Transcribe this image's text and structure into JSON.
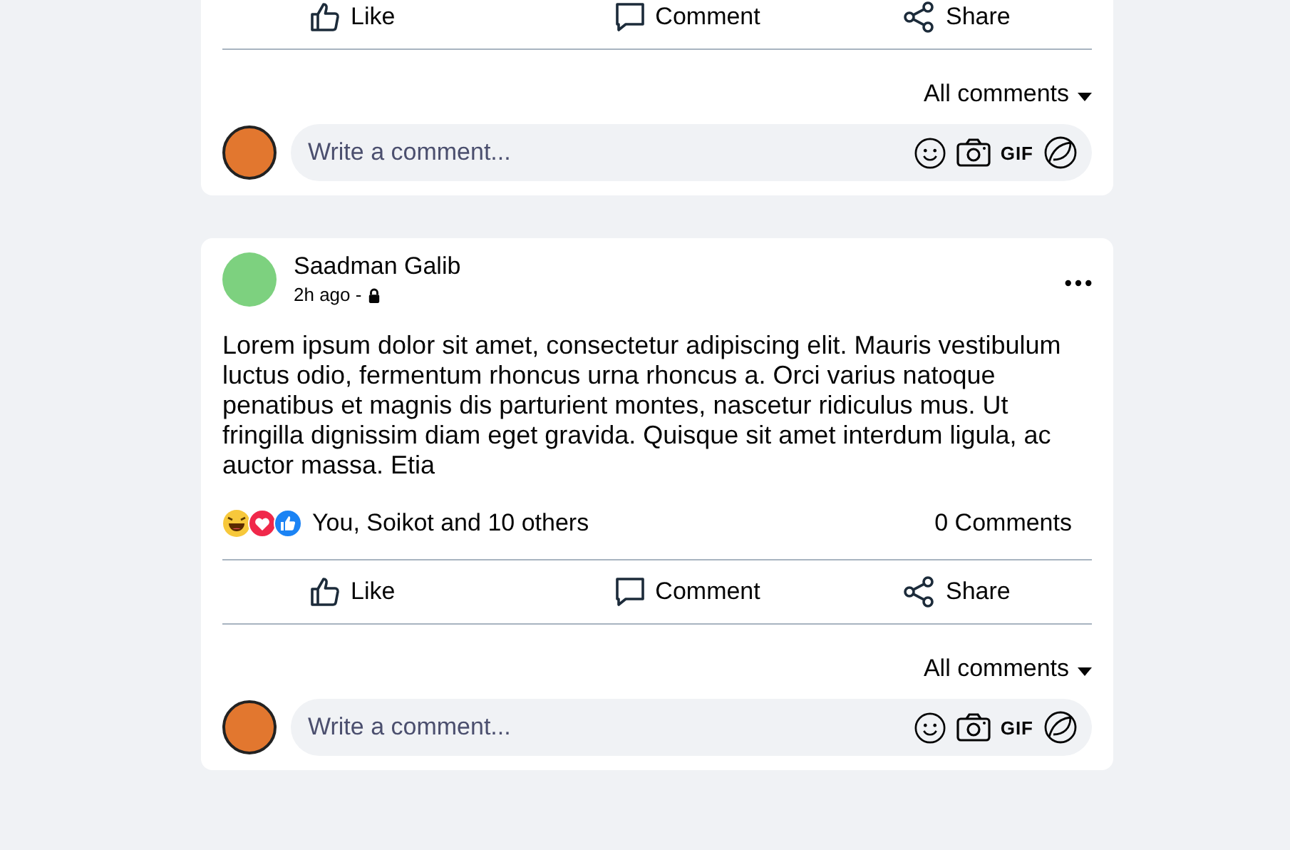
{
  "posts": [
    {
      "actions": [
        "Like",
        "Comment",
        "Share"
      ],
      "comments_filter": "All comments",
      "comment_field": {
        "placeholder": "Write a comment...",
        "gif_label": "GIF"
      }
    },
    {
      "author": {
        "name": "Saadman Galib",
        "time": "2h ago -"
      },
      "body": "Lorem ipsum dolor sit amet, consectetur adipiscing elit. Mauris vestibulum luctus odio, fermentum rhoncus urna rhoncus a. Orci varius natoque penatibus et magnis dis parturient montes, nascetur ridiculus mus. Ut fringilla dignissim diam eget gravida. Quisque sit amet interdum ligula, ac auctor massa. Etia",
      "reactions": {
        "text": "You, Soikot and 10 others",
        "comments_count": "0 Comments"
      },
      "actions": [
        "Like",
        "Comment",
        "Share"
      ],
      "comments_filter": "All comments",
      "comment_field": {
        "placeholder": "Write a comment...",
        "gif_label": "GIF"
      }
    }
  ]
}
